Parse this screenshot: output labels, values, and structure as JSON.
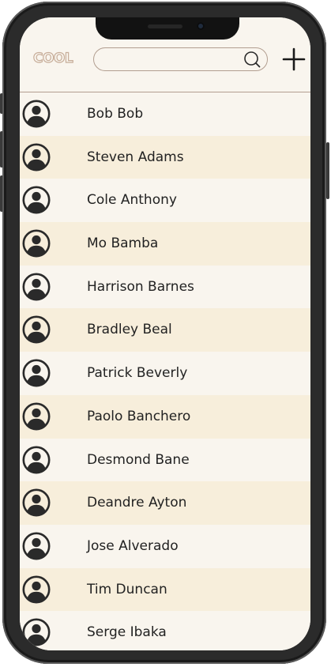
{
  "header": {
    "logo_text": "COOL",
    "search": {
      "placeholder": "",
      "value": "",
      "icon": "search-icon"
    },
    "add_button_icon": "plus-icon"
  },
  "contacts": [
    {
      "name": "Bob Bob",
      "icon": "user-avatar-icon"
    },
    {
      "name": "Steven Adams",
      "icon": "user-avatar-icon"
    },
    {
      "name": "Cole Anthony",
      "icon": "user-avatar-icon"
    },
    {
      "name": "Mo Bamba",
      "icon": "user-avatar-icon"
    },
    {
      "name": "Harrison Barnes",
      "icon": "user-avatar-icon"
    },
    {
      "name": "Bradley Beal",
      "icon": "user-avatar-icon"
    },
    {
      "name": "Patrick Beverly",
      "icon": "user-avatar-icon"
    },
    {
      "name": "Paolo Banchero",
      "icon": "user-avatar-icon"
    },
    {
      "name": "Desmond Bane",
      "icon": "user-avatar-icon"
    },
    {
      "name": "Deandre Ayton",
      "icon": "user-avatar-icon"
    },
    {
      "name": "Jose Alverado",
      "icon": "user-avatar-icon"
    },
    {
      "name": "Tim Duncan",
      "icon": "user-avatar-icon"
    },
    {
      "name": "Serge Ibaka",
      "icon": "user-avatar-icon"
    }
  ],
  "colors": {
    "background": "#f9f5ee",
    "row_alt": "#f7eedb",
    "accent": "#b29e90",
    "text": "#222222"
  }
}
